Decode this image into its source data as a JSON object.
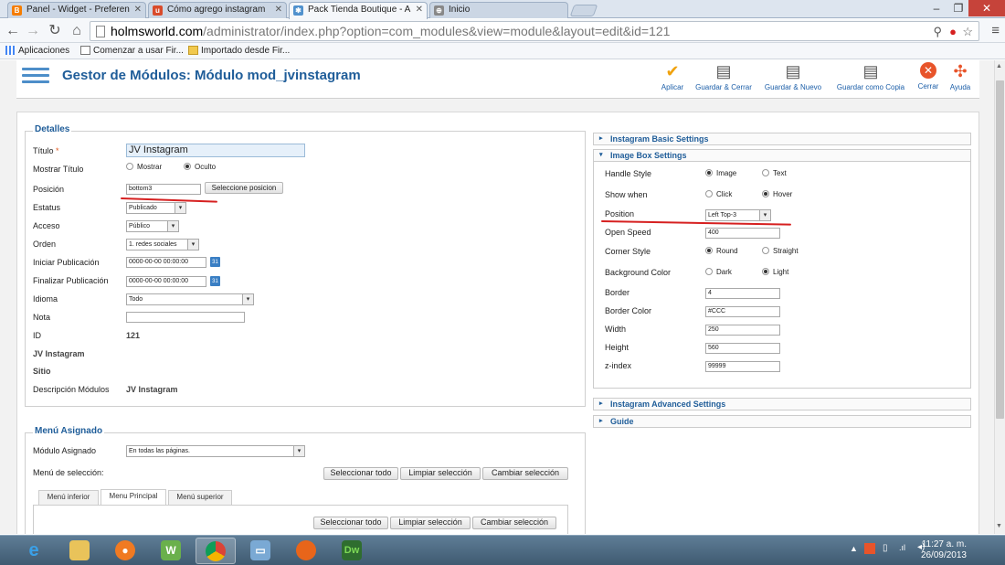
{
  "browser": {
    "tabs": [
      {
        "title": "Panel - Widget - Preferen",
        "icon": "blogger-icon",
        "color": "#f57d00"
      },
      {
        "title": "Cómo agrego instagram",
        "icon": "wp-icon",
        "color": "#d94b2b"
      },
      {
        "title": "Pack Tienda Boutique - A",
        "icon": "joomla-icon",
        "color": "#5091cd",
        "active": true
      },
      {
        "title": "Inicio",
        "icon": "globe-icon",
        "color": "#888888"
      }
    ],
    "url_domain": "holmsworld.com",
    "url_path": "/administrator/index.php?option=com_modules&view=module&layout=edit&id=121",
    "bookmarks": [
      "Aplicaciones",
      "Comenzar a usar Fir...",
      "Importado desde Fir..."
    ]
  },
  "header": {
    "title": "Gestor de Módulos: Módulo mod_jvinstagram",
    "toolbar": [
      "Aplicar",
      "Guardar & Cerrar",
      "Guardar & Nuevo",
      "Guardar como Copia",
      "Cerrar",
      "Ayuda"
    ]
  },
  "details": {
    "legend": "Detalles",
    "title_label": "Título",
    "title_required": "*",
    "title_value": "JV Instagram",
    "show_title_label": "Mostrar Título",
    "show_option": "Mostrar",
    "hide_option": "Oculto",
    "position_label": "Posición",
    "position_value": "bottom3",
    "position_button": "Seleccione posicion",
    "status_label": "Estatus",
    "status_value": "Publicado",
    "access_label": "Acceso",
    "access_value": "Público",
    "order_label": "Orden",
    "order_value": "1. redes sociales",
    "start_label": "Iniciar Publicación",
    "start_value": "0000-00-00 00:00:00",
    "finish_label": "Finalizar Publicación",
    "finish_value": "0000-00-00 00:00:00",
    "language_label": "Idioma",
    "language_value": "Todo",
    "note_label": "Nota",
    "id_label": "ID",
    "id_value": "121",
    "module_name": "JV Instagram",
    "site_label": "Sitio",
    "desc_label": "Descripción Módulos",
    "desc_value": "JV Instagram"
  },
  "menu": {
    "legend": "Menú Asignado",
    "assign_label": "Módulo Asignado",
    "assign_value": "En todas las páginas.",
    "selection_label": "Menú de selección:",
    "buttons": [
      "Seleccionar todo",
      "Limpiar selección",
      "Cambiar selección"
    ],
    "tabs": [
      "Menú inferior",
      "Menu Principal",
      "Menú superior"
    ]
  },
  "settings": {
    "basic": "Instagram Basic Settings",
    "image_box": "Image Box Settings",
    "advanced": "Instagram Advanced Settings",
    "guide": "Guide",
    "handle_style_label": "Handle Style",
    "handle_opts": [
      "Image",
      "Text"
    ],
    "show_when_label": "Show when",
    "show_when_opts": [
      "Click",
      "Hover"
    ],
    "position_label": "Position",
    "position_value": "Left Top-3",
    "open_speed_label": "Open Speed",
    "open_speed_value": "400",
    "corner_label": "Corner Style",
    "corner_opts": [
      "Round",
      "Straight"
    ],
    "bg_label": "Background Color",
    "bg_opts": [
      "Dark",
      "Light"
    ],
    "border_label": "Border",
    "border_value": "4",
    "border_color_label": "Border Color",
    "border_color_value": "#CCC",
    "width_label": "Width",
    "width_value": "250",
    "height_label": "Height",
    "height_value": "560",
    "zindex_label": "z-index",
    "zindex_value": "99999"
  },
  "taskbar": {
    "time": "11:27 a. m.",
    "date": "26/09/2013",
    "apps": [
      "ie-icon",
      "explorer-icon",
      "media-icon",
      "word-icon",
      "chrome-icon",
      "monitor-icon",
      "firefox-icon",
      "dreamweaver-icon"
    ],
    "dw_label": "Dw"
  },
  "colors": {
    "accent": "#1f5d99",
    "annotation": "#d62020"
  }
}
